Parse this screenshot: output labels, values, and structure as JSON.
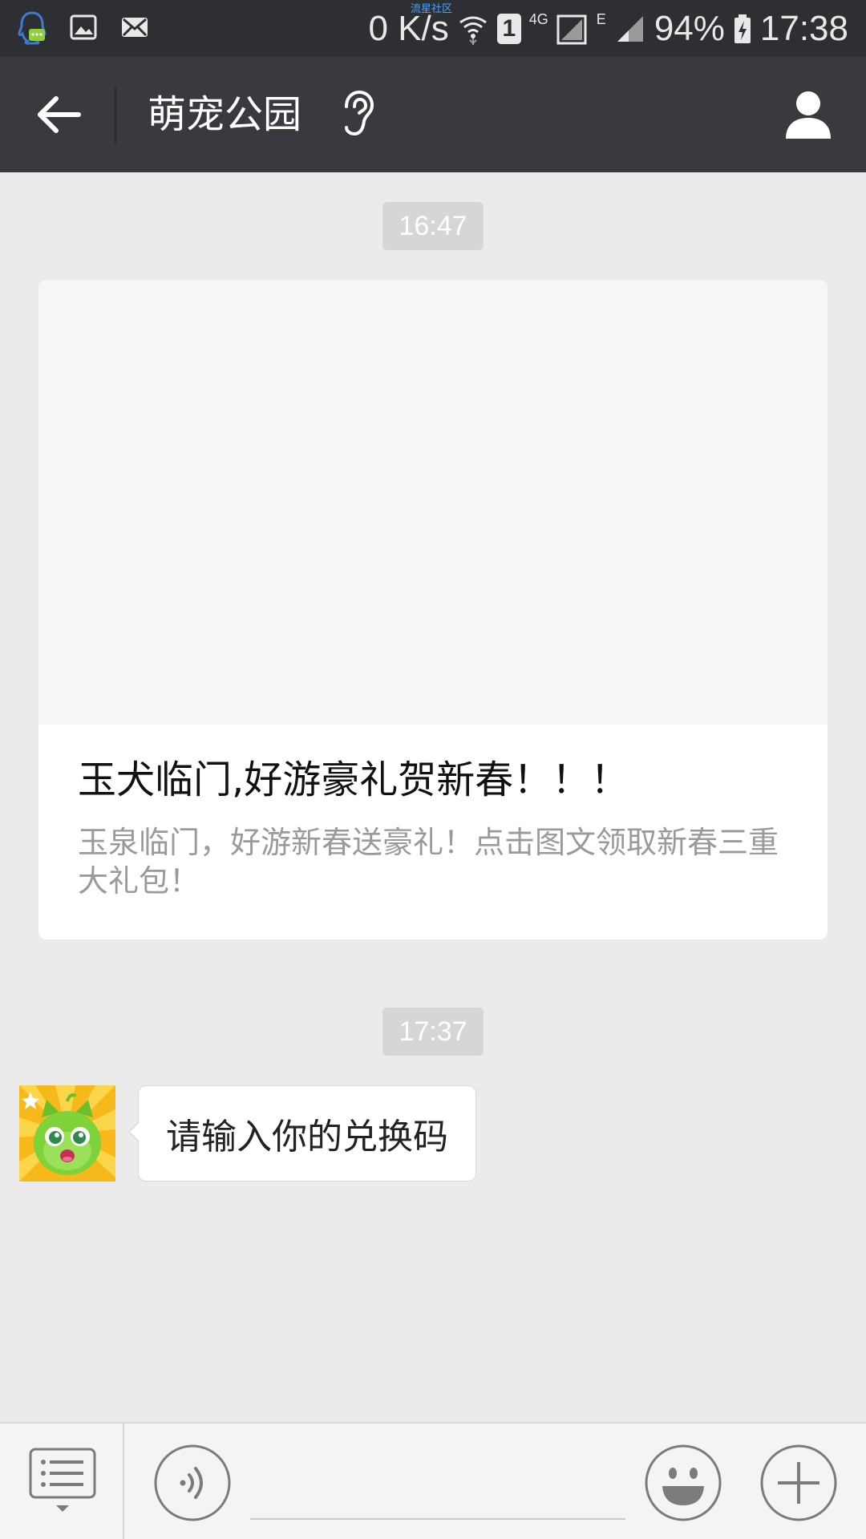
{
  "status_bar": {
    "carrier_tag": "流星社区",
    "net_speed": "0 K/s",
    "sim_slot": "1",
    "net_type_1": "4G",
    "net_type_2": "E",
    "battery": "94%",
    "time": "17:38",
    "icons": [
      "qq-icon",
      "image-notification-icon",
      "mail-icon",
      "wifi-icon",
      "signal-icon",
      "battery-charging-icon"
    ]
  },
  "header": {
    "title": "萌宠公园",
    "back_icon": "back-arrow-icon",
    "mode_icon": "ear-icon",
    "profile_icon": "person-icon"
  },
  "chat": {
    "timestamps": [
      "16:47",
      "17:37"
    ],
    "article": {
      "title": "玉犬临门,好游豪礼贺新春！！！",
      "description": "玉泉临门，好游新春送豪礼！点击图文领取新春三重大礼包！"
    },
    "message": {
      "text": "请输入你的兑换码",
      "avatar": "green-cat-avatar"
    }
  },
  "input_bar": {
    "menu_icon": "menu-list-icon",
    "voice_icon": "voice-icon",
    "input_value": "",
    "emoji_icon": "smiley-icon",
    "plus_icon": "plus-icon"
  },
  "colors": {
    "status_bar_bg": "#2e2f33",
    "title_bar_bg": "#393a3f",
    "chat_bg": "#ebebeb",
    "timestamp_bg": "#d6d6d6",
    "input_bar_bg": "#f4f4f6"
  }
}
